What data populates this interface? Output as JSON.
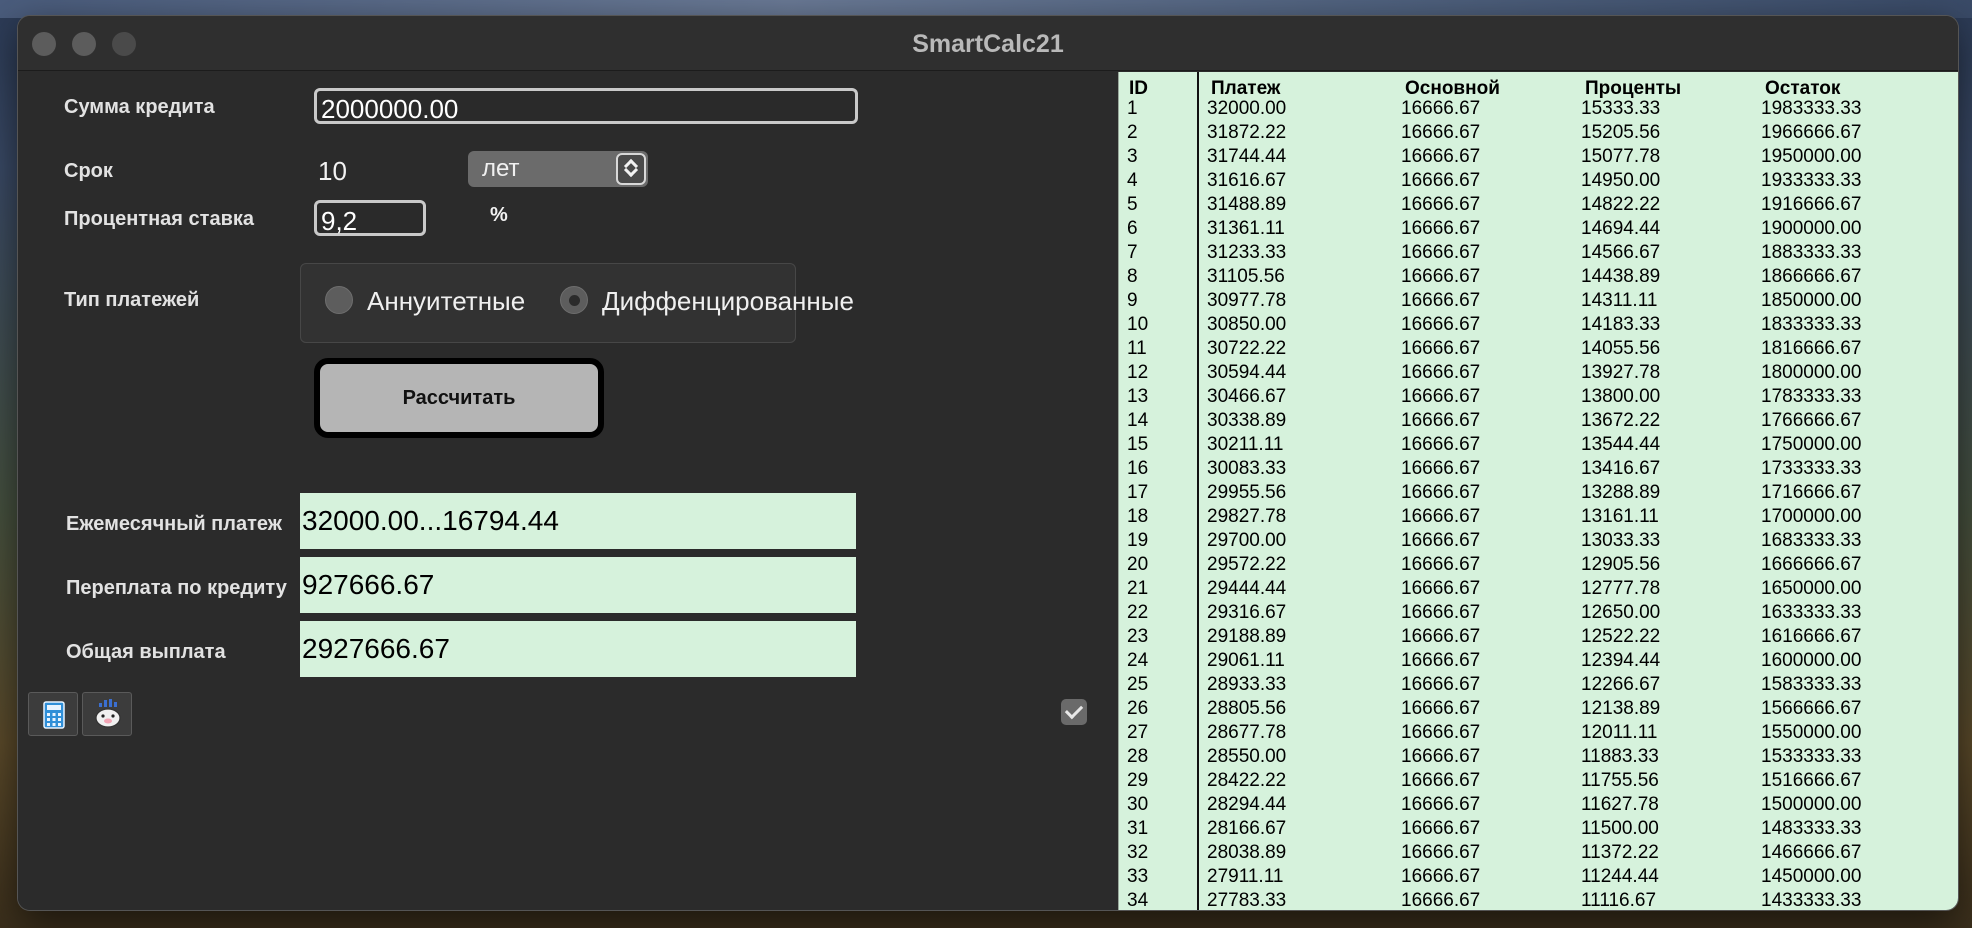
{
  "window": {
    "title": "SmartCalc21"
  },
  "form": {
    "amount_label": "Сумма кредита",
    "amount_value": "2000000.00",
    "term_label": "Срок",
    "term_value": "10",
    "term_unit": "лет",
    "rate_label": "Процентная ставка",
    "rate_value": "9,2",
    "rate_unit": "%",
    "type_label": "Тип платежей",
    "type_option_annuity": "Аннуитетные",
    "type_option_diff": "Диффенцированные",
    "selected_type": "diff",
    "calc_button": "Рассчитать"
  },
  "results": {
    "monthly_label": "Ежемесячный платеж",
    "monthly_value": "32000.00...16794.44",
    "overpay_label": "Переплата по кредиту",
    "overpay_value": "927666.67",
    "total_label": "Общая выплата",
    "total_value": "2927666.67"
  },
  "toolbar": {
    "icons": [
      "calculator-icon",
      "piggy-bank-icon"
    ],
    "checkbox_checked": true
  },
  "schedule": {
    "headers": [
      "ID",
      "Платеж",
      "Основной",
      "Проценты",
      "Остаток"
    ],
    "rows": [
      [
        "1",
        "32000.00",
        "16666.67",
        "15333.33",
        "1983333.33"
      ],
      [
        "2",
        "31872.22",
        "16666.67",
        "15205.56",
        "1966666.67"
      ],
      [
        "3",
        "31744.44",
        "16666.67",
        "15077.78",
        "1950000.00"
      ],
      [
        "4",
        "31616.67",
        "16666.67",
        "14950.00",
        "1933333.33"
      ],
      [
        "5",
        "31488.89",
        "16666.67",
        "14822.22",
        "1916666.67"
      ],
      [
        "6",
        "31361.11",
        "16666.67",
        "14694.44",
        "1900000.00"
      ],
      [
        "7",
        "31233.33",
        "16666.67",
        "14566.67",
        "1883333.33"
      ],
      [
        "8",
        "31105.56",
        "16666.67",
        "14438.89",
        "1866666.67"
      ],
      [
        "9",
        "30977.78",
        "16666.67",
        "14311.11",
        "1850000.00"
      ],
      [
        "10",
        "30850.00",
        "16666.67",
        "14183.33",
        "1833333.33"
      ],
      [
        "11",
        "30722.22",
        "16666.67",
        "14055.56",
        "1816666.67"
      ],
      [
        "12",
        "30594.44",
        "16666.67",
        "13927.78",
        "1800000.00"
      ],
      [
        "13",
        "30466.67",
        "16666.67",
        "13800.00",
        "1783333.33"
      ],
      [
        "14",
        "30338.89",
        "16666.67",
        "13672.22",
        "1766666.67"
      ],
      [
        "15",
        "30211.11",
        "16666.67",
        "13544.44",
        "1750000.00"
      ],
      [
        "16",
        "30083.33",
        "16666.67",
        "13416.67",
        "1733333.33"
      ],
      [
        "17",
        "29955.56",
        "16666.67",
        "13288.89",
        "1716666.67"
      ],
      [
        "18",
        "29827.78",
        "16666.67",
        "13161.11",
        "1700000.00"
      ],
      [
        "19",
        "29700.00",
        "16666.67",
        "13033.33",
        "1683333.33"
      ],
      [
        "20",
        "29572.22",
        "16666.67",
        "12905.56",
        "1666666.67"
      ],
      [
        "21",
        "29444.44",
        "16666.67",
        "12777.78",
        "1650000.00"
      ],
      [
        "22",
        "29316.67",
        "16666.67",
        "12650.00",
        "1633333.33"
      ],
      [
        "23",
        "29188.89",
        "16666.67",
        "12522.22",
        "1616666.67"
      ],
      [
        "24",
        "29061.11",
        "16666.67",
        "12394.44",
        "1600000.00"
      ],
      [
        "25",
        "28933.33",
        "16666.67",
        "12266.67",
        "1583333.33"
      ],
      [
        "26",
        "28805.56",
        "16666.67",
        "12138.89",
        "1566666.67"
      ],
      [
        "27",
        "28677.78",
        "16666.67",
        "12011.11",
        "1550000.00"
      ],
      [
        "28",
        "28550.00",
        "16666.67",
        "11883.33",
        "1533333.33"
      ],
      [
        "29",
        "28422.22",
        "16666.67",
        "11755.56",
        "1516666.67"
      ],
      [
        "30",
        "28294.44",
        "16666.67",
        "11627.78",
        "1500000.00"
      ],
      [
        "31",
        "28166.67",
        "16666.67",
        "11500.00",
        "1483333.33"
      ],
      [
        "32",
        "28038.89",
        "16666.67",
        "11372.22",
        "1466666.67"
      ],
      [
        "33",
        "27911.11",
        "16666.67",
        "11244.44",
        "1450000.00"
      ],
      [
        "34",
        "27783.33",
        "16666.67",
        "11116.67",
        "1433333.33"
      ]
    ]
  }
}
